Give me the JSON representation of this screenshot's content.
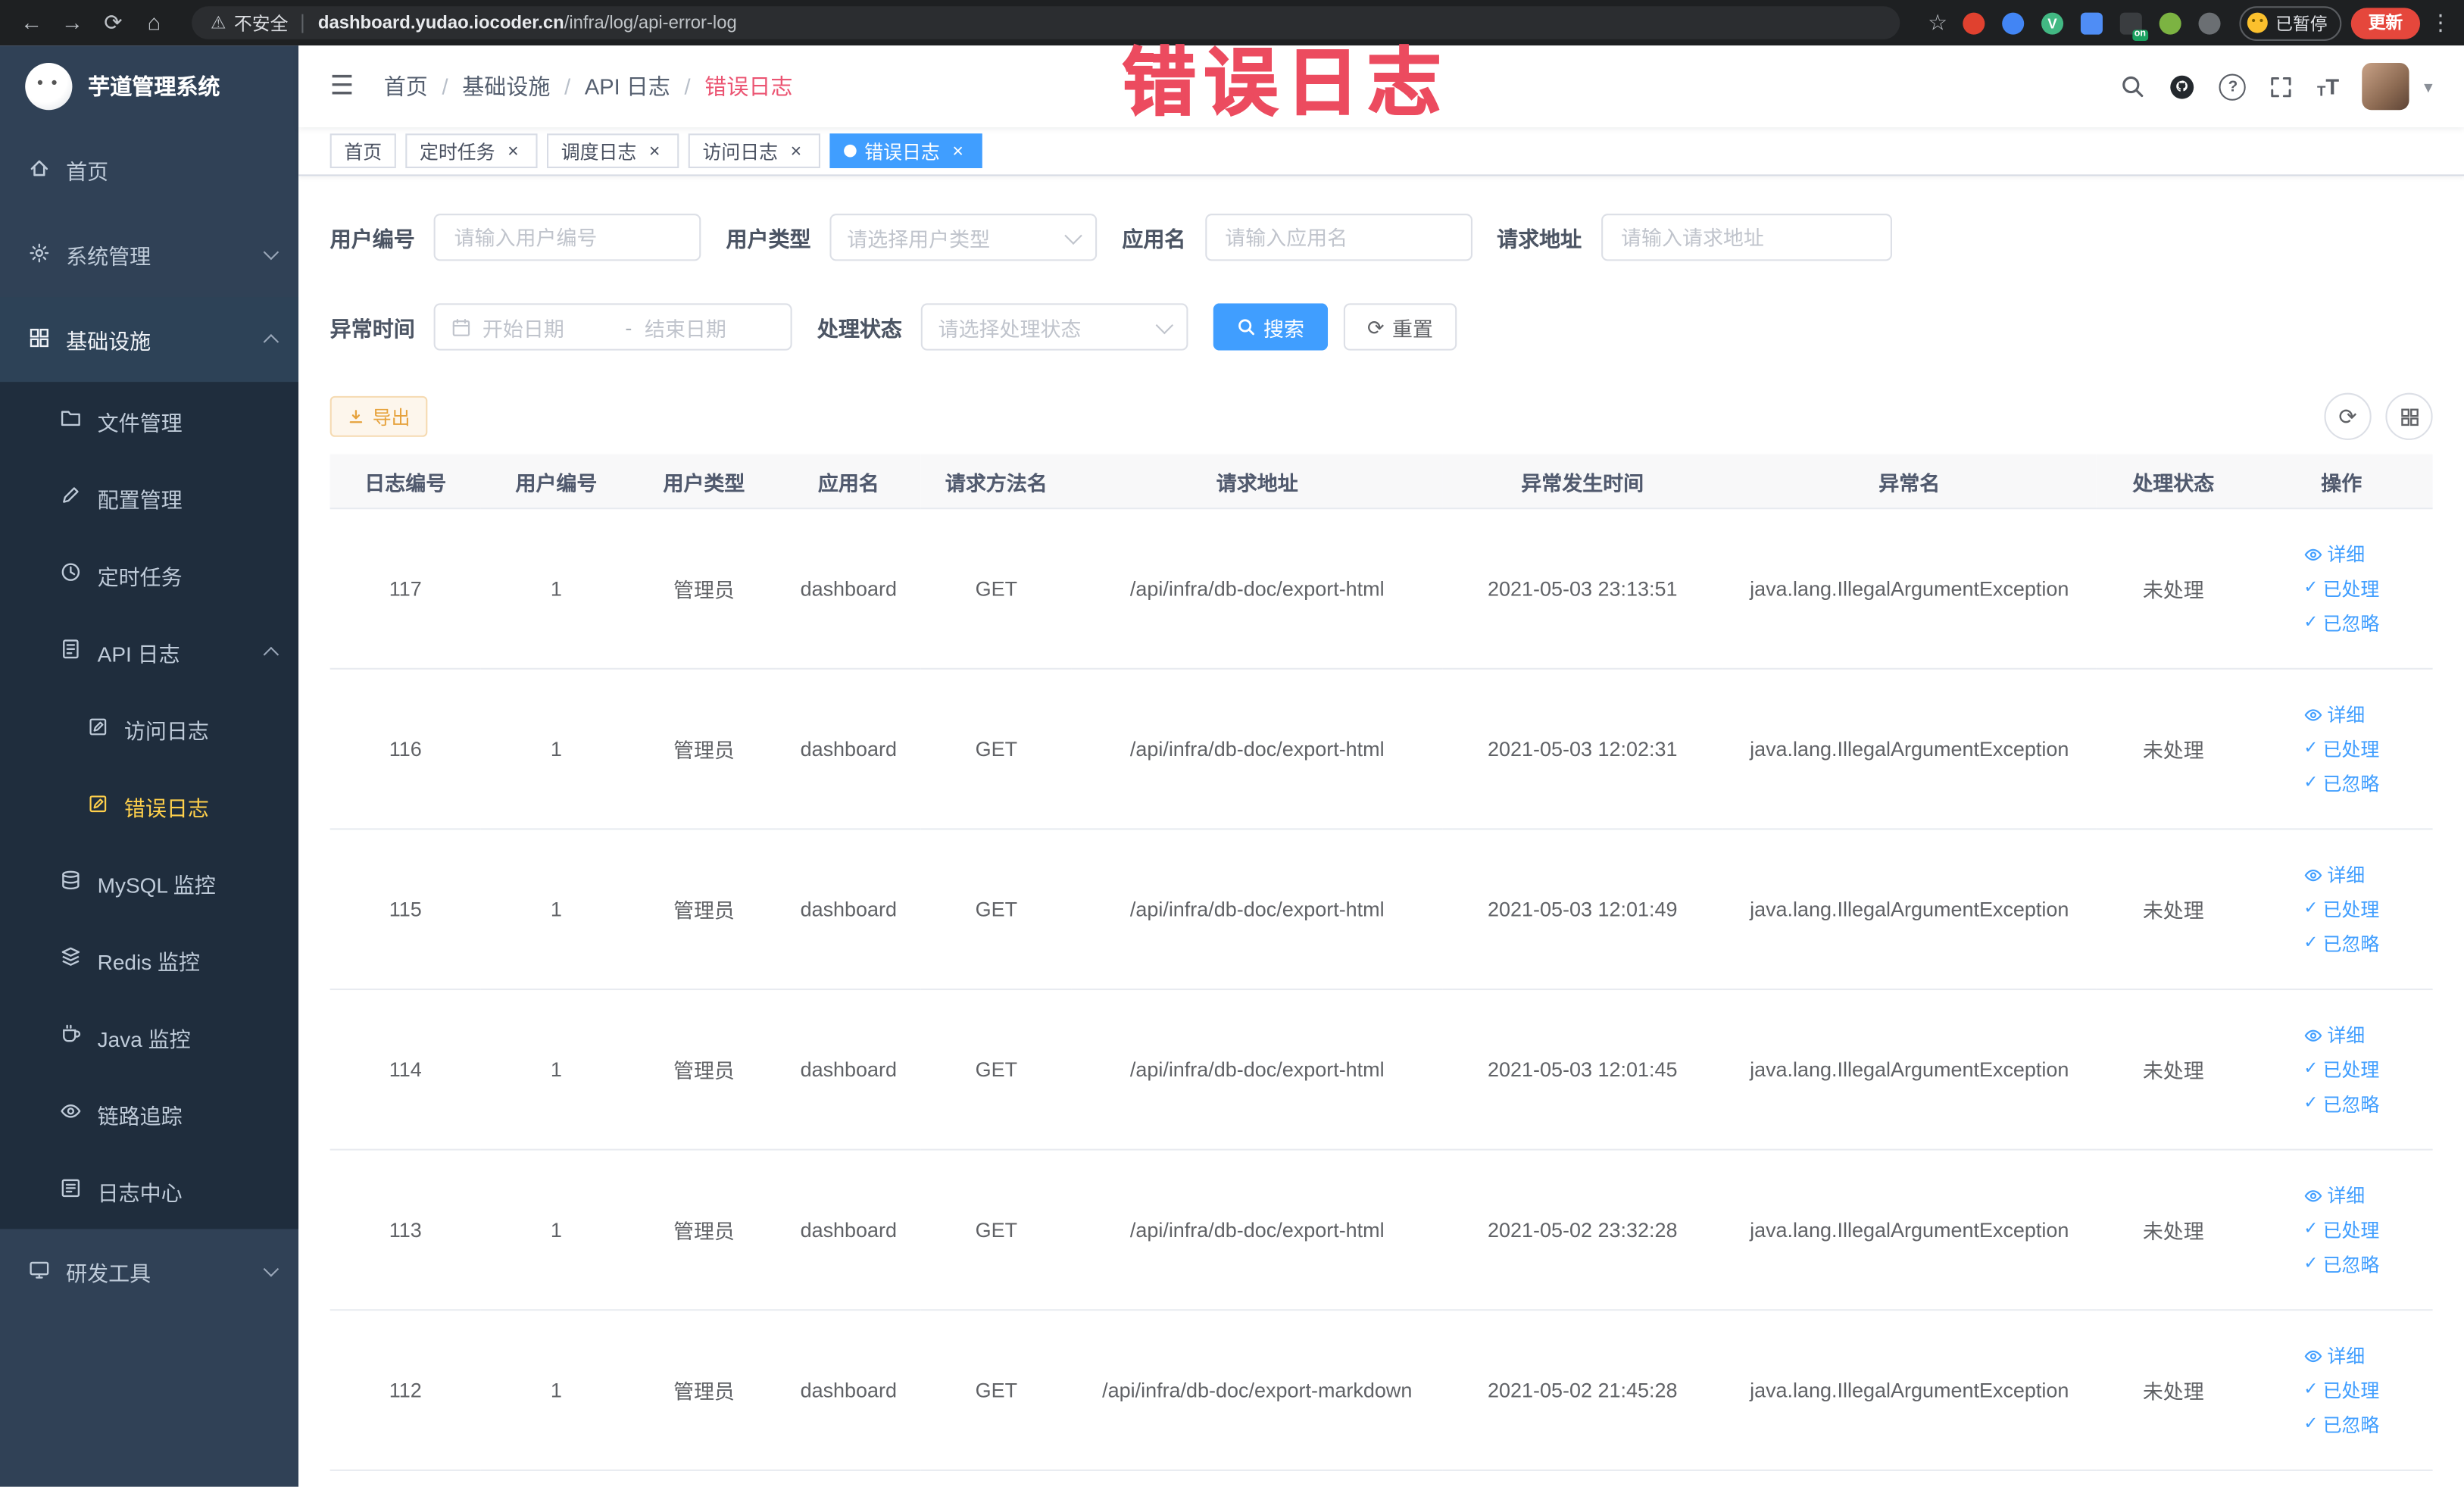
{
  "browser": {
    "security_label": "不安全",
    "url_host": "dashboard.yudao.iocoder.cn",
    "url_path": "/infra/log/api-error-log",
    "extension_on_badge": "on",
    "paused_badge": "已暂停",
    "update_button": "更新"
  },
  "annotation": {
    "watermark": "错误日志"
  },
  "icons": {
    "back": "←",
    "forward": "→",
    "reload": "⟳",
    "home": "⌂",
    "warning": "⚠",
    "star": "☆",
    "overflow": "⋮",
    "hamburger": "☰",
    "caret": "▾",
    "close": "×",
    "check": "✓",
    "question": "?",
    "text_size_small": "T",
    "text_size_big": "T",
    "refresh": "⟳",
    "v_extension": "V"
  },
  "sidebar": {
    "logo_title": "芋道管理系统",
    "items": {
      "home": "首页",
      "system": "系统管理",
      "infra": "基础设施",
      "file": "文件管理",
      "config": "配置管理",
      "job": "定时任务",
      "api_log": "API 日志",
      "access_log": "访问日志",
      "error_log": "错误日志",
      "mysql": "MySQL 监控",
      "redis": "Redis 监控",
      "java": "Java 监控",
      "trace": "链路追踪",
      "log_center": "日志中心",
      "dev_tools": "研发工具"
    }
  },
  "navbar": {
    "breadcrumb": [
      "首页",
      "基础设施",
      "API 日志",
      "错误日志"
    ]
  },
  "tabs": [
    {
      "label": "首页"
    },
    {
      "label": "定时任务"
    },
    {
      "label": "调度日志"
    },
    {
      "label": "访问日志"
    },
    {
      "label": "错误日志"
    }
  ],
  "filters": {
    "user_id": {
      "label": "用户编号",
      "placeholder": "请输入用户编号"
    },
    "user_type": {
      "label": "用户类型",
      "placeholder": "请选择用户类型"
    },
    "app_name": {
      "label": "应用名",
      "placeholder": "请输入应用名"
    },
    "request_url": {
      "label": "请求地址",
      "placeholder": "请输入请求地址"
    },
    "exception_time": {
      "label": "异常时间",
      "start_placeholder": "开始日期",
      "separator": "-",
      "end_placeholder": "结束日期"
    },
    "process_status": {
      "label": "处理状态",
      "placeholder": "请选择处理状态"
    },
    "search_button": "搜索",
    "reset_button": "重置"
  },
  "toolbar": {
    "export_button": "导出"
  },
  "table": {
    "headers": [
      "日志编号",
      "用户编号",
      "用户类型",
      "应用名",
      "请求方法名",
      "请求地址",
      "异常发生时间",
      "异常名",
      "处理状态",
      "操作"
    ],
    "rows": [
      [
        "117",
        "1",
        "管理员",
        "dashboard",
        "GET",
        "/api/infra/db-doc/export-html",
        "2021-05-03 23:13:51",
        "java.lang.IllegalArgumentException",
        "未处理"
      ],
      [
        "116",
        "1",
        "管理员",
        "dashboard",
        "GET",
        "/api/infra/db-doc/export-html",
        "2021-05-03 12:02:31",
        "java.lang.IllegalArgumentException",
        "未处理"
      ],
      [
        "115",
        "1",
        "管理员",
        "dashboard",
        "GET",
        "/api/infra/db-doc/export-html",
        "2021-05-03 12:01:49",
        "java.lang.IllegalArgumentException",
        "未处理"
      ],
      [
        "114",
        "1",
        "管理员",
        "dashboard",
        "GET",
        "/api/infra/db-doc/export-html",
        "2021-05-03 12:01:45",
        "java.lang.IllegalArgumentException",
        "未处理"
      ],
      [
        "113",
        "1",
        "管理员",
        "dashboard",
        "GET",
        "/api/infra/db-doc/export-html",
        "2021-05-02 23:32:28",
        "java.lang.IllegalArgumentException",
        "未处理"
      ],
      [
        "112",
        "1",
        "管理员",
        "dashboard",
        "GET",
        "/api/infra/db-doc/export-markdown",
        "2021-05-02 21:45:28",
        "java.lang.IllegalArgumentException",
        "未处理"
      ]
    ],
    "row_actions": {
      "detail": "详细",
      "processed": "已处理",
      "ignore": "已忽略"
    }
  },
  "colors": {
    "primary": "#409eff",
    "sidebar_bg": "#304156",
    "submenu_bg": "#1f2d3d",
    "active_menu_text": "#ffd04b",
    "warning_button_text": "#e6a23c",
    "annotation_red": "#ec4b5f"
  }
}
